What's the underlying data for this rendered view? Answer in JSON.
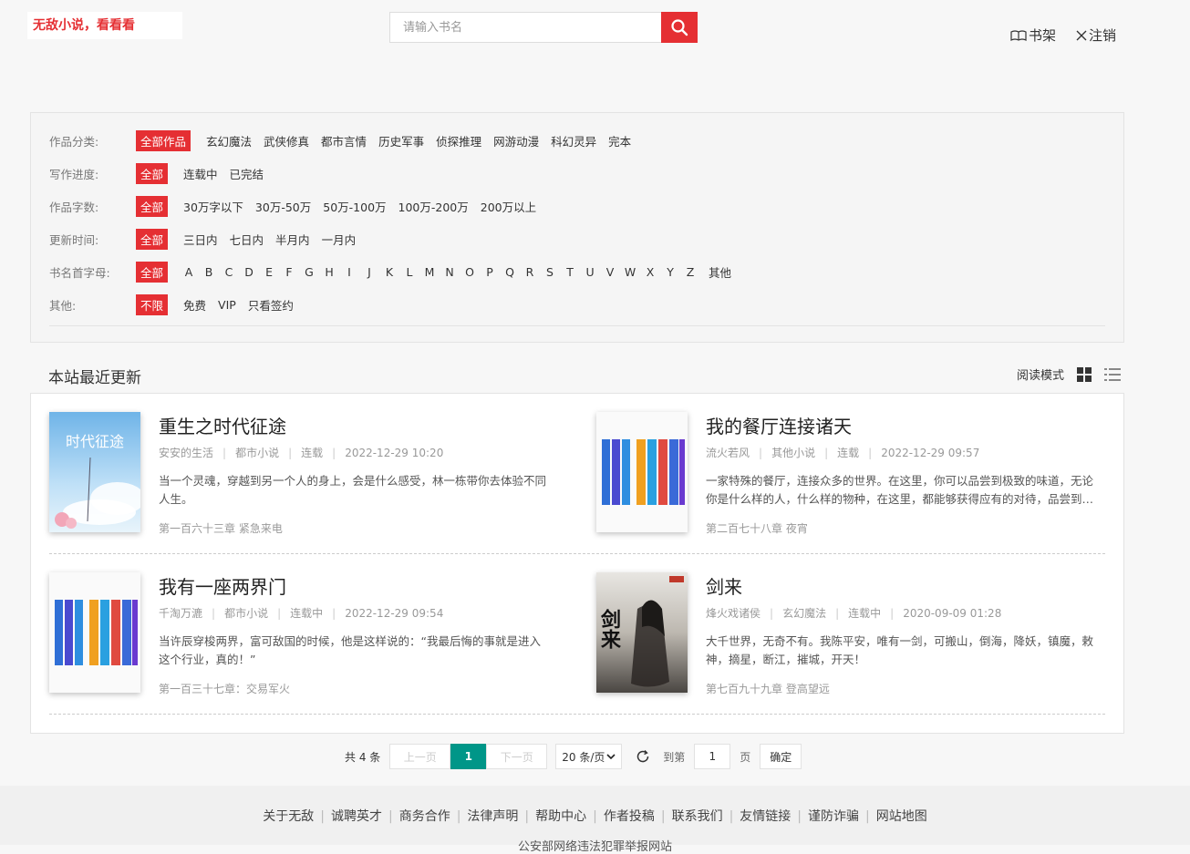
{
  "header": {
    "logo": "无敌小说，看看看",
    "search_placeholder": "请输入书名",
    "bookshelf": "书架",
    "logout": "注销"
  },
  "filters": [
    {
      "label": "作品分类:",
      "options": [
        "全部作品",
        "玄幻魔法",
        "武侠修真",
        "都市言情",
        "历史军事",
        "侦探推理",
        "网游动漫",
        "科幻灵异",
        "完本"
      ],
      "selected": 0
    },
    {
      "label": "写作进度:",
      "options": [
        "全部",
        "连载中",
        "已完结"
      ],
      "selected": 0
    },
    {
      "label": "作品字数:",
      "options": [
        "全部",
        "30万字以下",
        "30万-50万",
        "50万-100万",
        "100万-200万",
        "200万以上"
      ],
      "selected": 0
    },
    {
      "label": "更新时间:",
      "options": [
        "全部",
        "三日内",
        "七日内",
        "半月内",
        "一月内"
      ],
      "selected": 0
    },
    {
      "label": "书名首字母:",
      "options": [
        "全部",
        "A",
        "B",
        "C",
        "D",
        "E",
        "F",
        "G",
        "H",
        "I",
        "J",
        "K",
        "L",
        "M",
        "N",
        "O",
        "P",
        "Q",
        "R",
        "S",
        "T",
        "U",
        "V",
        "W",
        "X",
        "Y",
        "Z",
        "其他"
      ],
      "selected": 0
    },
    {
      "label": "其他:",
      "options": [
        "不限",
        "免费",
        "VIP",
        "只看签约"
      ],
      "selected": 0
    }
  ],
  "section": {
    "title": "本站最近更新",
    "read_mode": "阅读模式"
  },
  "books": [
    {
      "title": "重生之时代征途",
      "author": "安安的生活",
      "category": "都市小说",
      "status": "连载",
      "time": "2022-12-29 10:20",
      "desc": "当一个灵魂，穿越到另一个人的身上，会是什么感受，林一栋带你去体验不同人生。",
      "chapter": "第一百六十三章 紧急来电",
      "cover": "sky",
      "cover_text": "时代征途"
    },
    {
      "title": "我的餐厅连接诸天",
      "author": "流火若风",
      "category": "其他小说",
      "status": "连载",
      "time": "2022-12-29 09:57",
      "desc": "一家特殊的餐厅，连接众多的世界。在这里，你可以品尝到极致的味道，无论你是什么样的人，什么样的物种，在这里，都能够获得应有的对待，品尝到属于你的美味。",
      "chapter": "第二百七十八章 夜宵",
      "cover": "placeholder",
      "cover_text": ""
    },
    {
      "title": "我有一座两界门",
      "author": "千淘万漉",
      "category": "都市小说",
      "status": "连载中",
      "time": "2022-12-29 09:54",
      "desc": "当许辰穿梭两界，富可敌国的时候，他是这样说的：“我最后悔的事就是进入这个行业，真的！”",
      "chapter": "第一百三十七章：交易军火",
      "cover": "placeholder",
      "cover_text": ""
    },
    {
      "title": "剑来",
      "author": "烽火戏诸侯",
      "category": "玄幻魔法",
      "status": "连载中",
      "time": "2020-09-09 01:28",
      "desc": "大千世界，无奇不有。我陈平安，唯有一剑，可搬山，倒海，降妖，镇魔，敕神，摘星，断江，摧城，开天！",
      "chapter": "第七百九十九章 登高望远",
      "cover": "ink",
      "cover_text": "剑来"
    }
  ],
  "pager": {
    "total": "共 4 条",
    "prev": "上一页",
    "current": "1",
    "next": "下一页",
    "page_size": "20 条/页",
    "goto": "到第",
    "goto_value": "1",
    "page_unit": "页",
    "confirm": "确定"
  },
  "footer": {
    "links": [
      "关于无敌",
      "诚聘英才",
      "商务合作",
      "法律声明",
      "帮助中心",
      "作者投稿",
      "联系我们",
      "友情链接",
      "谨防诈骗",
      "网站地图"
    ],
    "line2": "公安部网络违法犯罪举报网站"
  }
}
